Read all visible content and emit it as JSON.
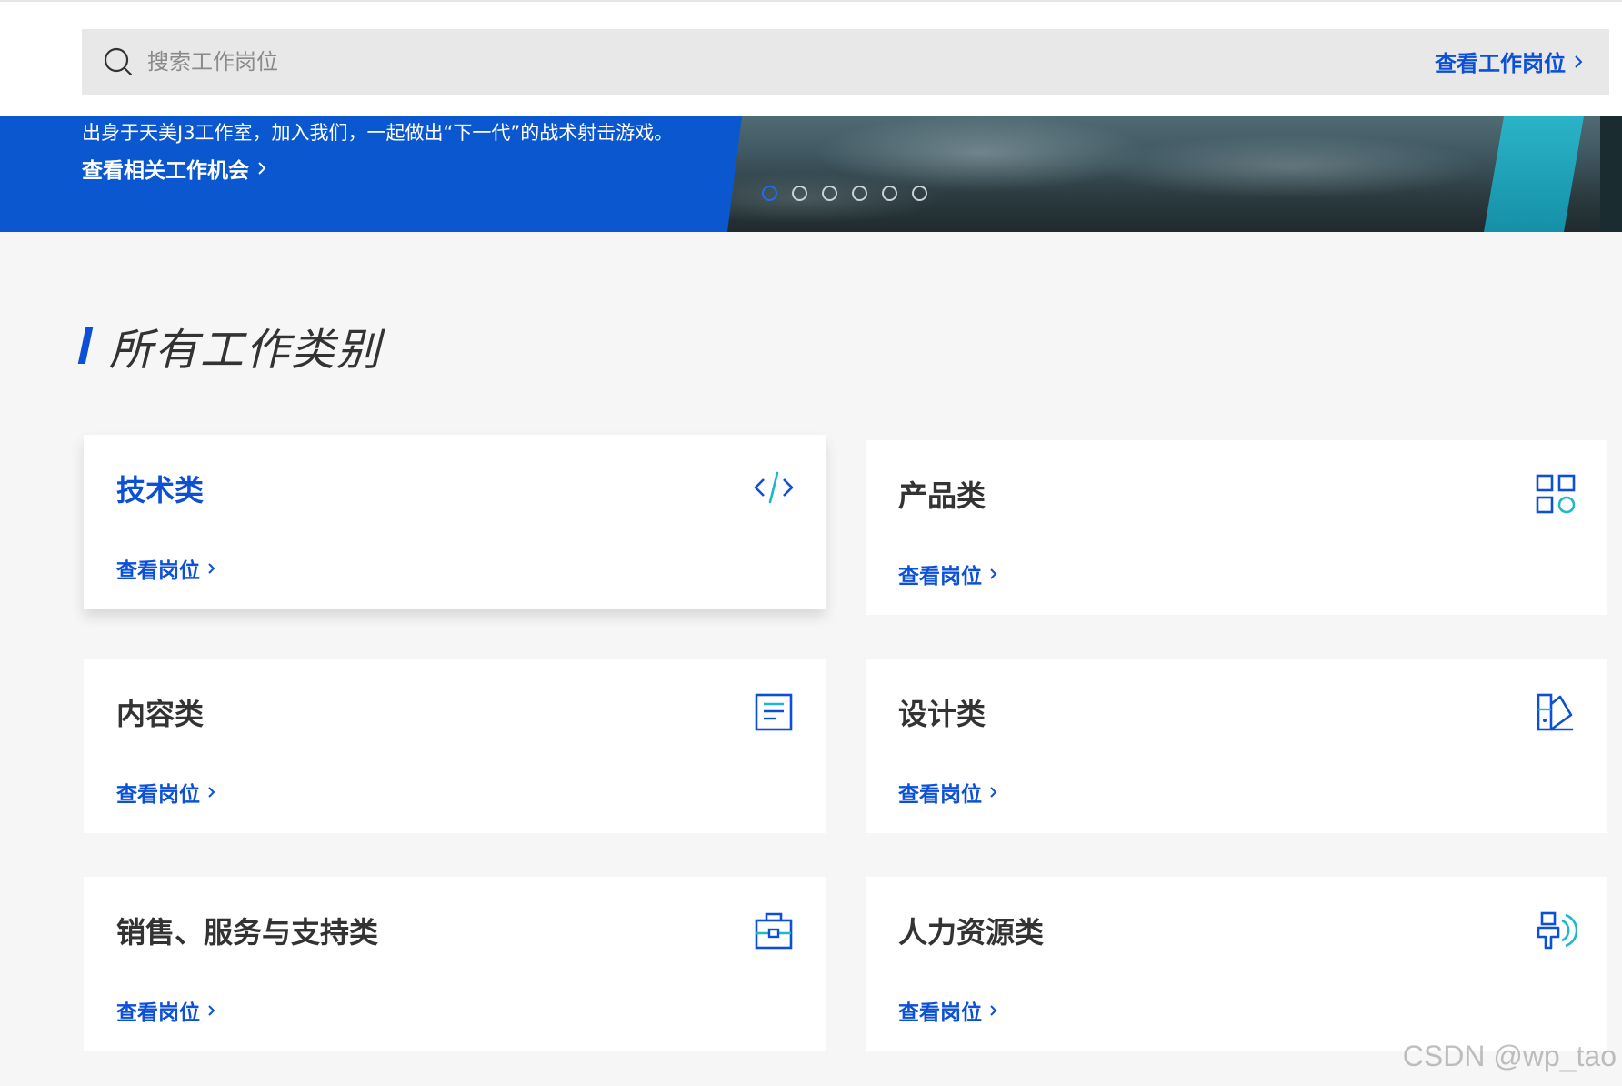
{
  "search": {
    "placeholder": "搜索工作岗位",
    "view_jobs_label": "查看工作岗位"
  },
  "banner": {
    "text": "出身于天美J3工作室，加入我们，一起做出“下一代”的战术射击游戏。",
    "link_label": "查看相关工作机会",
    "slide_count": 6,
    "active_slide": 1
  },
  "section": {
    "title": "所有工作类别"
  },
  "categories": [
    {
      "title": "技术类",
      "link": "查看岗位",
      "icon": "code-icon"
    },
    {
      "title": "产品类",
      "link": "查看岗位",
      "icon": "grid-apps-icon"
    },
    {
      "title": "内容类",
      "link": "查看岗位",
      "icon": "document-icon"
    },
    {
      "title": "设计类",
      "link": "查看岗位",
      "icon": "design-palette-icon"
    },
    {
      "title": "销售、服务与支持类",
      "link": "查看岗位",
      "icon": "briefcase-icon"
    },
    {
      "title": "人力资源类",
      "link": "查看岗位",
      "icon": "hr-people-icon"
    }
  ],
  "colors": {
    "brand_blue": "#0b50d6",
    "accent_teal": "#1fb8c9",
    "page_bg": "#f6f6f6"
  },
  "watermark": "CSDN @wp_tao"
}
